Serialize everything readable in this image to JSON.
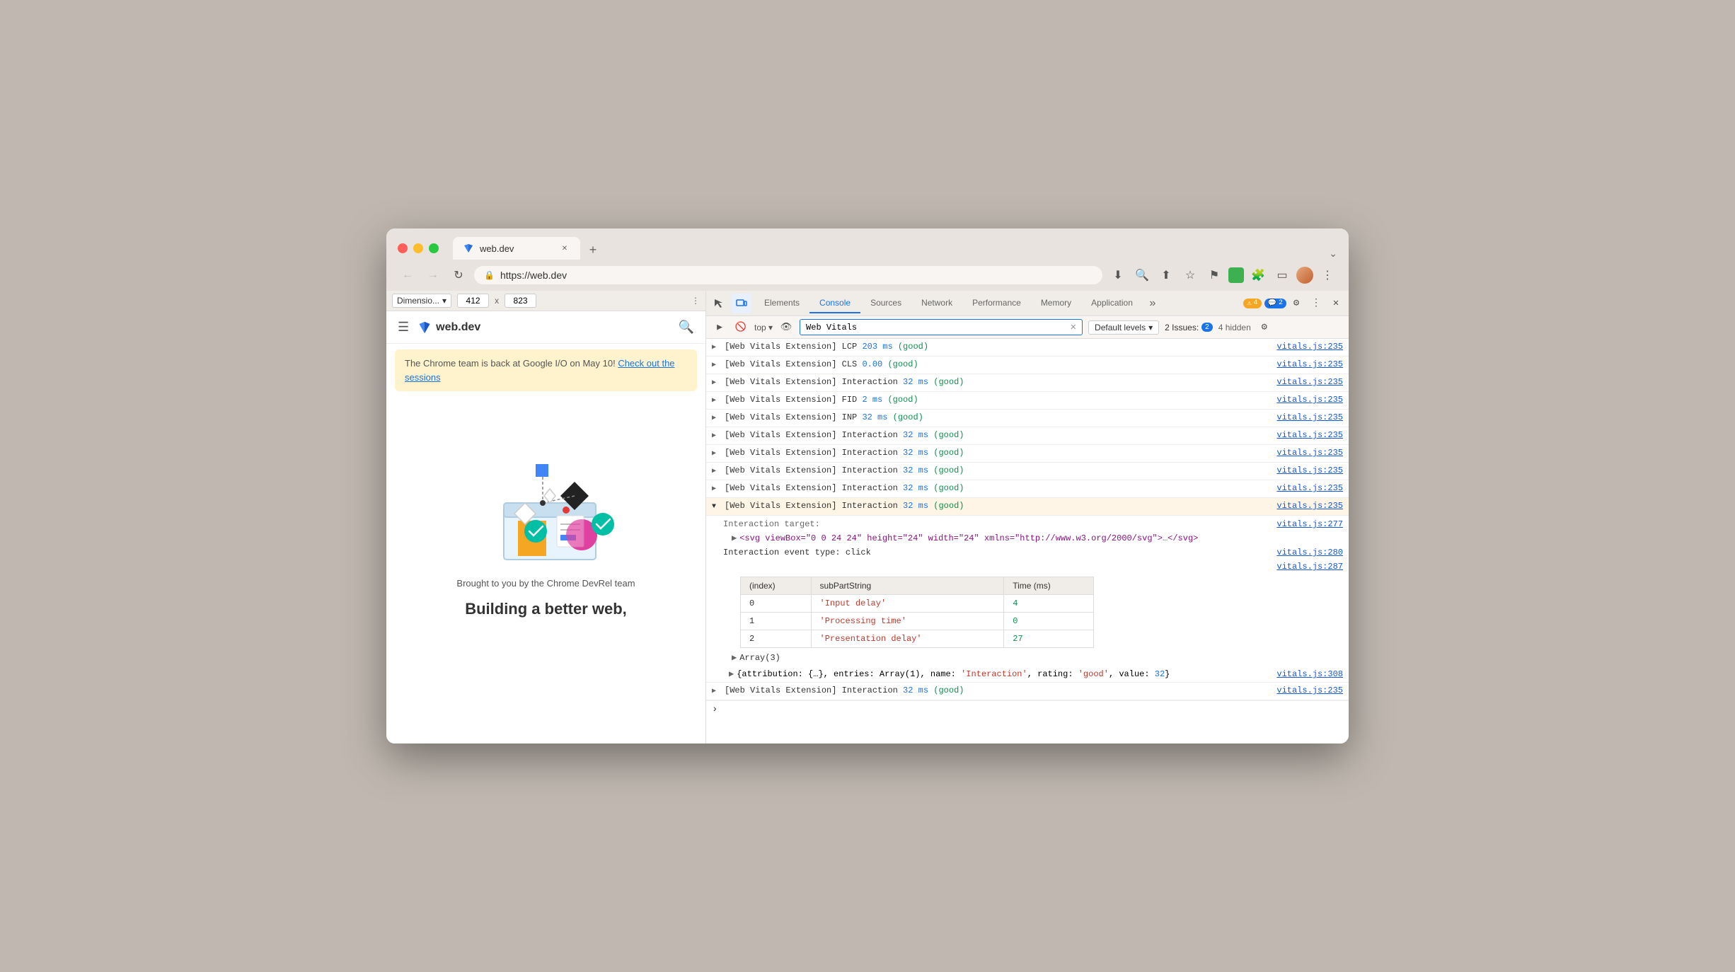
{
  "browser": {
    "traffic_lights": [
      "red",
      "yellow",
      "green"
    ],
    "tab": {
      "title": "web.dev",
      "favicon": "🔷"
    },
    "new_tab": "+",
    "chevron": "⌄",
    "nav": {
      "back": "←",
      "forward": "→",
      "reload": "↻",
      "lock": "🔒",
      "address": "https://web.dev"
    },
    "toolbar": {
      "download": "⬇",
      "zoom": "🔍",
      "share": "⬆",
      "star": "☆",
      "flag": "⚑",
      "puzzle": "🧩",
      "sidebar": "⬛",
      "more": "⋮"
    }
  },
  "devtools": {
    "dim_bar": {
      "label": "Dimensio...",
      "width": "412",
      "x": "x",
      "height": "823"
    },
    "tabs": [
      {
        "label": "Elements",
        "active": false
      },
      {
        "label": "Console",
        "active": true
      },
      {
        "label": "Sources",
        "active": false
      },
      {
        "label": "Network",
        "active": false
      },
      {
        "label": "Performance",
        "active": false
      },
      {
        "label": "Memory",
        "active": false
      },
      {
        "label": "Application",
        "active": false
      }
    ],
    "tab_icons": {
      "inspect": "⬚",
      "device": "📱"
    },
    "badges": {
      "warning_count": "4",
      "warning_icon": "⚠",
      "info_count": "2",
      "info_icon": "💬"
    },
    "settings_icon": "⚙",
    "more_icon": "⋮",
    "close_icon": "✕",
    "console_toolbar": {
      "clear_icon": "🚫",
      "filter_icon": "🔍",
      "top_context": "top",
      "eye_icon": "👁",
      "filter_value": "Web Vitals",
      "clear_filter": "✕",
      "levels_label": "Default levels",
      "issues_label": "2 Issues:",
      "issues_count": "2",
      "hidden_label": "4 hidden",
      "gear_icon": "⚙"
    },
    "console_rows": [
      {
        "id": 1,
        "expanded": false,
        "text": "[Web Vitals Extension] LCP ",
        "value": "203 ms",
        "value_class": "blue-num",
        "suffix": " (good)",
        "suffix_class": "green-val",
        "link": "vitals.js:235"
      },
      {
        "id": 2,
        "expanded": false,
        "text": "[Web Vitals Extension] CLS ",
        "value": "0.00",
        "value_class": "blue-num",
        "suffix": " (good)",
        "suffix_class": "green-val",
        "link": "vitals.js:235"
      },
      {
        "id": 3,
        "expanded": false,
        "text": "[Web Vitals Extension] Interaction ",
        "value": "32 ms",
        "value_class": "blue-num",
        "suffix": " (good)",
        "suffix_class": "green-val",
        "link": "vitals.js:235"
      },
      {
        "id": 4,
        "expanded": false,
        "text": "[Web Vitals Extension] FID ",
        "value": "2 ms",
        "value_class": "blue-num",
        "suffix": " (good)",
        "suffix_class": "green-val",
        "link": "vitals.js:235"
      },
      {
        "id": 5,
        "expanded": false,
        "text": "[Web Vitals Extension] INP ",
        "value": "32 ms",
        "value_class": "blue-num",
        "suffix": " (good)",
        "suffix_class": "green-val",
        "link": "vitals.js:235"
      },
      {
        "id": 6,
        "expanded": false,
        "text": "[Web Vitals Extension] Interaction ",
        "value": "32 ms",
        "value_class": "blue-num",
        "suffix": " (good)",
        "suffix_class": "green-val",
        "link": "vitals.js:235"
      },
      {
        "id": 7,
        "expanded": false,
        "text": "[Web Vitals Extension] Interaction ",
        "value": "32 ms",
        "value_class": "blue-num",
        "suffix": " (good)",
        "suffix_class": "green-val",
        "link": "vitals.js:235"
      },
      {
        "id": 8,
        "expanded": false,
        "text": "[Web Vitals Extension] Interaction ",
        "value": "32 ms",
        "value_class": "blue-num",
        "suffix": " (good)",
        "suffix_class": "green-val",
        "link": "vitals.js:235"
      },
      {
        "id": 9,
        "expanded": false,
        "text": "[Web Vitals Extension] Interaction ",
        "value": "32 ms",
        "value_class": "blue-num",
        "suffix": " (good)",
        "suffix_class": "green-val",
        "link": "vitals.js:235"
      },
      {
        "id": 10,
        "expanded": false,
        "text": "[Web Vitals Extension] Interaction ",
        "value": "32 ms",
        "value_class": "blue-num",
        "suffix": " (good)",
        "suffix_class": "green-val",
        "link": "vitals.js:235"
      }
    ],
    "expanded_entry": {
      "main_text": "[Web Vitals Extension] Interaction ",
      "main_value": "32 ms",
      "main_suffix": " (good)",
      "main_link": "vitals.js:235",
      "interaction_target_label": "Interaction target:",
      "svg_text": "► <svg viewBox=\"0 0 24 24\" height=\"24\" width=\"24\" xmlns=\"http://www.w3.org/2000/svg\"> … </svg>",
      "svg_link": "vitals.js:277",
      "event_type_text": "Interaction event type: click",
      "event_type_link": "vitals.js:280",
      "empty_link": "vitals.js:287",
      "table": {
        "headers": [
          "(index)",
          "subPartString",
          "Time (ms)"
        ],
        "rows": [
          {
            "index": "0",
            "subPart": "'Input delay'",
            "time": "4"
          },
          {
            "index": "1",
            "subPart": "'Processing time'",
            "time": "0"
          },
          {
            "index": "2",
            "subPart": "'Presentation delay'",
            "time": "27"
          }
        ]
      },
      "array_text": "► Array(3)",
      "attribution_text": "► {attribution: {…}, entries: Array(1), name: 'Interaction', rating: 'good', value: 32}",
      "attribution_link": "vitals.js:308"
    },
    "last_row": {
      "text": "[Web Vitals Extension] Interaction ",
      "value": "32 ms",
      "suffix": " (good)",
      "link": "vitals.js:235"
    }
  },
  "webdev": {
    "logo_text": "web.dev",
    "banner": {
      "text": "The Chrome team is back at Google I/O on May 10! ",
      "link_text": "Check out the sessions"
    },
    "brought_by": "Brought to you by the Chrome DevRel team",
    "building_text": "Building a better web,"
  }
}
